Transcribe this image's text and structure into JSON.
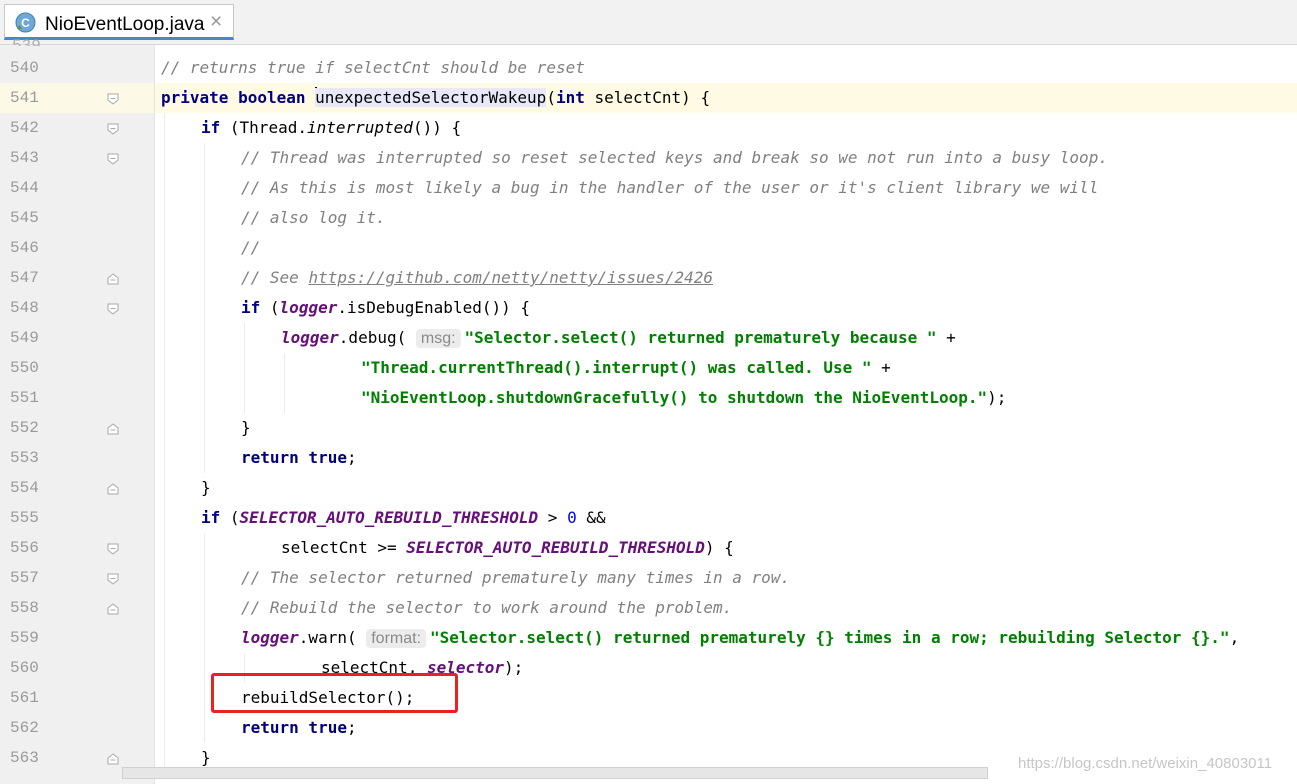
{
  "tab": {
    "title": "NioEventLoop.java",
    "icon": "java-class-icon",
    "close_glyph": "×"
  },
  "editor": {
    "partial_top_line": "539",
    "current_line": "541",
    "lines": [
      {
        "num": "540",
        "indent": 4,
        "tokens": [
          [
            "cm",
            "// returns true if selectCnt should be reset"
          ]
        ]
      },
      {
        "num": "541",
        "indent": 4,
        "tokens": [
          [
            "kw",
            "private boolean "
          ],
          [
            "caret",
            ""
          ],
          [
            "method",
            "unexpectedSelectorWakeup"
          ],
          [
            "p",
            "("
          ],
          [
            "kw",
            "int "
          ],
          [
            "p",
            "selectCnt) {"
          ]
        ]
      },
      {
        "num": "542",
        "indent": 8,
        "tokens": [
          [
            "kw",
            "if "
          ],
          [
            "p",
            "(Thread."
          ],
          [
            "st",
            "interrupted"
          ],
          [
            "p",
            "()) {"
          ]
        ]
      },
      {
        "num": "543",
        "indent": 12,
        "tokens": [
          [
            "cm",
            "// Thread was interrupted so reset selected keys and break so we not run into a busy loop."
          ]
        ]
      },
      {
        "num": "544",
        "indent": 12,
        "tokens": [
          [
            "cm",
            "// As this is most likely a bug in the handler of the user or it's client library we will"
          ]
        ]
      },
      {
        "num": "545",
        "indent": 12,
        "tokens": [
          [
            "cm",
            "// also log it."
          ]
        ]
      },
      {
        "num": "546",
        "indent": 12,
        "tokens": [
          [
            "cm",
            "//"
          ]
        ]
      },
      {
        "num": "547",
        "indent": 12,
        "tokens": [
          [
            "cm",
            "// See "
          ],
          [
            "lnk",
            "https://github.com/netty/netty/issues/2426"
          ]
        ]
      },
      {
        "num": "548",
        "indent": 12,
        "tokens": [
          [
            "kw",
            "if "
          ],
          [
            "p",
            "("
          ],
          [
            "fld",
            "logger"
          ],
          [
            "p",
            ".isDebugEnabled()) {"
          ]
        ]
      },
      {
        "num": "549",
        "indent": 16,
        "tokens": [
          [
            "fld",
            "logger"
          ],
          [
            "p",
            ".debug( "
          ],
          [
            "hint",
            "msg:"
          ],
          [
            "str",
            "\"Selector.select() returned prematurely because \""
          ],
          [
            "p",
            " +"
          ]
        ]
      },
      {
        "num": "550",
        "indent": 24,
        "tokens": [
          [
            "str",
            "\"Thread.currentThread().interrupt() was called. Use \""
          ],
          [
            "p",
            " +"
          ]
        ]
      },
      {
        "num": "551",
        "indent": 24,
        "tokens": [
          [
            "str",
            "\"NioEventLoop.shutdownGracefully() to shutdown the NioEventLoop.\""
          ],
          [
            "p",
            ");"
          ]
        ]
      },
      {
        "num": "552",
        "indent": 12,
        "tokens": [
          [
            "p",
            "}"
          ]
        ]
      },
      {
        "num": "553",
        "indent": 12,
        "tokens": [
          [
            "kw",
            "return true"
          ],
          [
            "p",
            ";"
          ]
        ]
      },
      {
        "num": "554",
        "indent": 8,
        "tokens": [
          [
            "p",
            "}"
          ]
        ]
      },
      {
        "num": "555",
        "indent": 8,
        "tokens": [
          [
            "kw",
            "if "
          ],
          [
            "p",
            "("
          ],
          [
            "fld",
            "SELECTOR_AUTO_REBUILD_THRESHOLD"
          ],
          [
            "p",
            " > "
          ],
          [
            "num",
            "0"
          ],
          [
            "p",
            " &&"
          ]
        ]
      },
      {
        "num": "556",
        "indent": 16,
        "tokens": [
          [
            "p",
            "selectCnt >= "
          ],
          [
            "fld",
            "SELECTOR_AUTO_REBUILD_THRESHOLD"
          ],
          [
            "p",
            ") {"
          ]
        ]
      },
      {
        "num": "557",
        "indent": 12,
        "tokens": [
          [
            "cm",
            "// The selector returned prematurely many times in a row."
          ]
        ]
      },
      {
        "num": "558",
        "indent": 12,
        "tokens": [
          [
            "cm",
            "// Rebuild the selector to work around the problem."
          ]
        ]
      },
      {
        "num": "559",
        "indent": 12,
        "tokens": [
          [
            "fld",
            "logger"
          ],
          [
            "p",
            ".warn( "
          ],
          [
            "hint",
            "format:"
          ],
          [
            "str",
            "\"Selector.select() returned prematurely {} times in a row; rebuilding Selector {}.\""
          ],
          [
            "p",
            ","
          ]
        ]
      },
      {
        "num": "560",
        "indent": 20,
        "tokens": [
          [
            "p",
            "selectCnt, "
          ],
          [
            "fld",
            "selector"
          ],
          [
            "p",
            ");"
          ]
        ]
      },
      {
        "num": "561",
        "indent": 12,
        "tokens": [
          [
            "p",
            "rebuildSelector();"
          ]
        ]
      },
      {
        "num": "562",
        "indent": 12,
        "tokens": [
          [
            "kw",
            "return true"
          ],
          [
            "p",
            ";"
          ]
        ]
      },
      {
        "num": "563",
        "indent": 8,
        "tokens": [
          [
            "p",
            "}"
          ]
        ]
      }
    ],
    "folds": [
      {
        "line": "541",
        "kind": "open"
      },
      {
        "line": "542",
        "kind": "open"
      },
      {
        "line": "543",
        "kind": "open"
      },
      {
        "line": "547",
        "kind": "close"
      },
      {
        "line": "548",
        "kind": "open"
      },
      {
        "line": "552",
        "kind": "close"
      },
      {
        "line": "554",
        "kind": "close"
      },
      {
        "line": "556",
        "kind": "open"
      },
      {
        "line": "557",
        "kind": "open"
      },
      {
        "line": "558",
        "kind": "close"
      },
      {
        "line": "563",
        "kind": "close"
      }
    ],
    "highlighted_line": "561"
  },
  "watermark": "https://blog.csdn.net/weixin_40803011",
  "colors": {
    "keyword": "#000080",
    "comment": "#808080",
    "string": "#008000",
    "field": "#660e7a",
    "number": "#0000ff",
    "highlight_box": "#e8221e",
    "current_line": "#fffae3"
  }
}
